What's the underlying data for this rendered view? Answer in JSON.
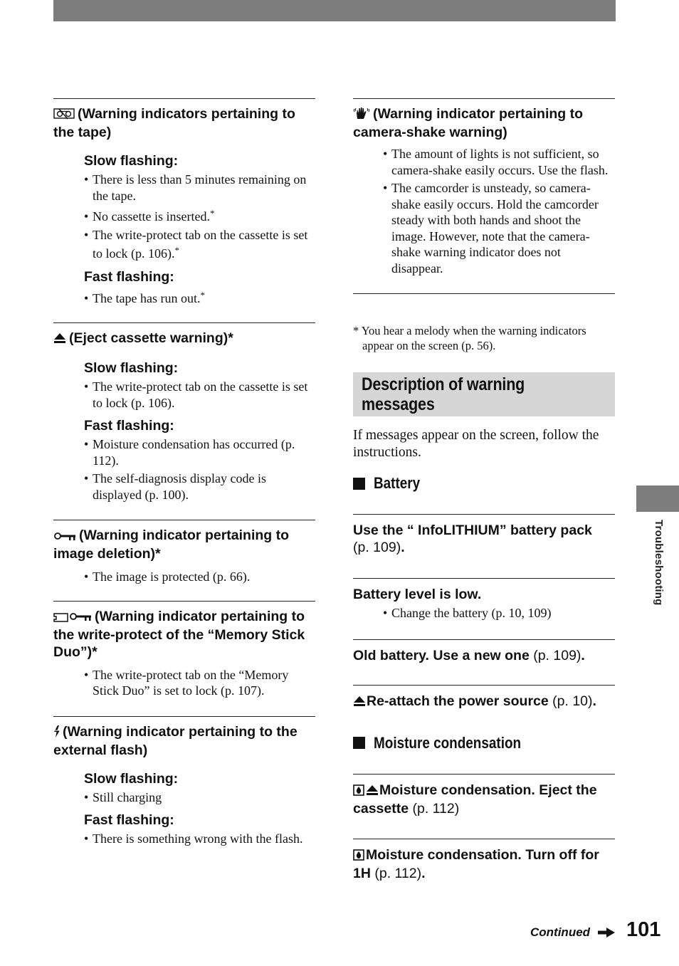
{
  "left_column": {
    "sections": [
      {
        "icon": "tape-warning-icon",
        "title": "(Warning indicators pertaining to the tape)",
        "groups": [
          {
            "label": "Slow flashing:",
            "items": [
              {
                "text": "There is less than 5 minutes remaining on the tape.",
                "mark": ""
              },
              {
                "text": "No cassette is inserted.",
                "mark": "*"
              },
              {
                "text": "The write-protect tab on the cassette is set to lock (p. 106).",
                "mark": "*"
              }
            ]
          },
          {
            "label": "Fast flashing:",
            "items": [
              {
                "text": "The tape has run out.",
                "mark": "*"
              }
            ]
          }
        ]
      },
      {
        "icon": "eject-icon",
        "title": "(Eject cassette warning)*",
        "groups": [
          {
            "label": "Slow flashing:",
            "items": [
              {
                "text": "The write-protect tab on the cassette is set to lock (p. 106).",
                "mark": ""
              }
            ]
          },
          {
            "label": "Fast flashing:",
            "items": [
              {
                "text": "Moisture condensation has occurred (p. 112).",
                "mark": ""
              },
              {
                "text": "The self-diagnosis display code is displayed (p. 100).",
                "mark": ""
              }
            ]
          }
        ]
      },
      {
        "icon": "protect-key-icon",
        "title": "(Warning indicator pertaining to image deletion)*",
        "items": [
          {
            "text": "The image is protected (p. 66).",
            "mark": ""
          }
        ]
      },
      {
        "icon": "memory-stick-protect-icon",
        "title": "(Warning indicator pertaining to the write-protect of the “Memory Stick Duo”)*",
        "items": [
          {
            "text": "The write-protect tab on the “Memory Stick Duo” is set to lock (p. 107).",
            "mark": ""
          }
        ]
      },
      {
        "icon": "flash-icon",
        "title": "(Warning indicator pertaining to the external flash)",
        "groups": [
          {
            "label": "Slow flashing:",
            "items": [
              {
                "text": "Still charging",
                "mark": ""
              }
            ]
          },
          {
            "label": "Fast flashing:",
            "items": [
              {
                "text": "There is something wrong with the flash.",
                "mark": ""
              }
            ]
          }
        ]
      }
    ]
  },
  "right_column": {
    "camera_shake": {
      "icon": "camera-shake-icon",
      "title": "(Warning indicator pertaining to camera-shake warning)",
      "items": [
        "The amount of lights is not sufficient, so camera-shake easily occurs. Use the flash.",
        "The camcorder is unsteady, so camera-shake easily occurs. Hold the camcorder steady with both hands and shoot the image. However, note that the camera-shake warning indicator does not disappear."
      ]
    },
    "footnote": "* You hear a melody when the warning indicators appear on the screen (p. 56).",
    "section_title_line1": "Description of warning",
    "section_title_line2": "messages",
    "intro": "If messages appear on the screen, follow the instructions.",
    "battery": {
      "heading": "Battery",
      "messages": [
        {
          "bold": "Use the “ InfoLITHIUM” battery pack",
          "ref": "(p. 109)",
          "end": ".",
          "bullets": []
        },
        {
          "bold": "Battery level is low.",
          "ref": "",
          "end": "",
          "bullets": [
            "Change the battery (p. 10, 109)"
          ]
        },
        {
          "bold": "Old battery. Use a new one",
          "ref": "(p. 109)",
          "end": ".",
          "bullets": []
        },
        {
          "bold": "Re-attach the power source",
          "ref": "(p. 10)",
          "end": ".",
          "bullets": [],
          "icon": "eject-icon"
        }
      ]
    },
    "moisture": {
      "heading": "Moisture condensation",
      "messages": [
        {
          "bold": "Moisture condensation. Eject the cassette",
          "ref": "(p. 112)",
          "end": "",
          "icons": [
            "moisture-icon",
            "eject-icon"
          ]
        },
        {
          "bold": "Moisture condensation. Turn off for 1H",
          "ref": "(p. 112)",
          "end": ".",
          "icons": [
            "moisture-icon"
          ]
        }
      ]
    }
  },
  "side_tab_label": "Troubleshooting",
  "footer": {
    "continued": "Continued",
    "page_number": "101"
  },
  "colors": {
    "top_bar": "#7d7d7d",
    "side_tab": "#7d7d7d",
    "section_band": "#d6d6d6",
    "text": "#111111"
  }
}
